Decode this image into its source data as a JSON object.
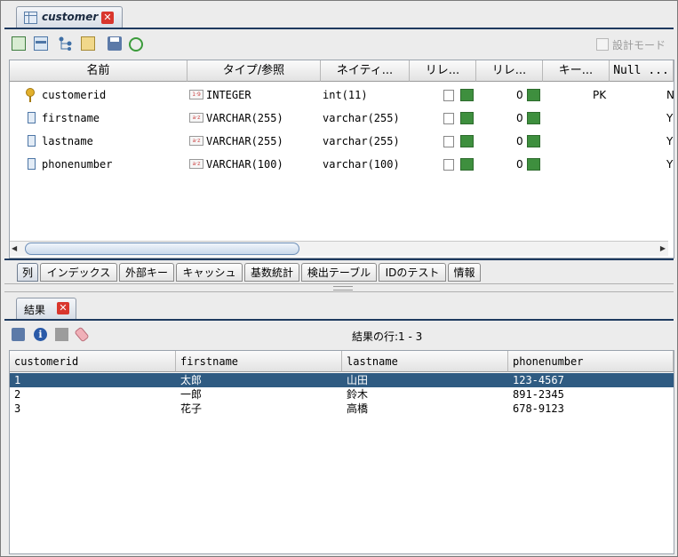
{
  "editor_tab": {
    "title": "customer",
    "icon": "table-icon"
  },
  "toolbar": {
    "design_mode_label": "設計モード",
    "icons": [
      "add-column-icon",
      "grid-icon",
      "relation-tree-icon",
      "properties-icon",
      "save-icon",
      "refresh-icon"
    ]
  },
  "columns_table": {
    "headers": [
      "名前",
      "タイプ/参照",
      "ネイティ...",
      "リレ...",
      "リレ...",
      "キー...",
      "Null ..."
    ],
    "rows": [
      {
        "name": "customerid",
        "type": "INTEGER",
        "native": "int(11)",
        "rel_count": "0",
        "key": "PK",
        "null": "N",
        "icon": "key-icon",
        "type_icon": "number-type-icon"
      },
      {
        "name": "firstname",
        "type": "VARCHAR(255)",
        "native": "varchar(255)",
        "rel_count": "0",
        "key": "",
        "null": "Y",
        "icon": "column-icon",
        "type_icon": "string-type-icon"
      },
      {
        "name": "lastname",
        "type": "VARCHAR(255)",
        "native": "varchar(255)",
        "rel_count": "0",
        "key": "",
        "null": "Y",
        "icon": "column-icon",
        "type_icon": "string-type-icon"
      },
      {
        "name": "phonenumber",
        "type": "VARCHAR(100)",
        "native": "varchar(100)",
        "rel_count": "0",
        "key": "",
        "null": "Y",
        "icon": "column-icon",
        "type_icon": "string-type-icon"
      }
    ],
    "type_icon_text": {
      "int": "1·9",
      "str": "a·z"
    }
  },
  "bottom_tabs": [
    "列",
    "インデックス",
    "外部キー",
    "キャッシュ",
    "基数統計",
    "検出テーブル",
    "IDのテスト",
    "情報"
  ],
  "results_tab": {
    "title": "結果"
  },
  "results": {
    "rows_label": "結果の行:1 - 3",
    "headers": [
      "customerid",
      "firstname",
      "lastname",
      "phonenumber"
    ],
    "rows": [
      [
        "1",
        "太郎",
        "山田",
        "123-4567"
      ],
      [
        "2",
        "一郎",
        "鈴木",
        "891-2345"
      ],
      [
        "3",
        "花子",
        "高橋",
        "678-9123"
      ]
    ],
    "selected_row": 0
  },
  "colors": {
    "selection": "#2f5b82",
    "close": "#d9362d",
    "rule": "#1e3a5f"
  }
}
